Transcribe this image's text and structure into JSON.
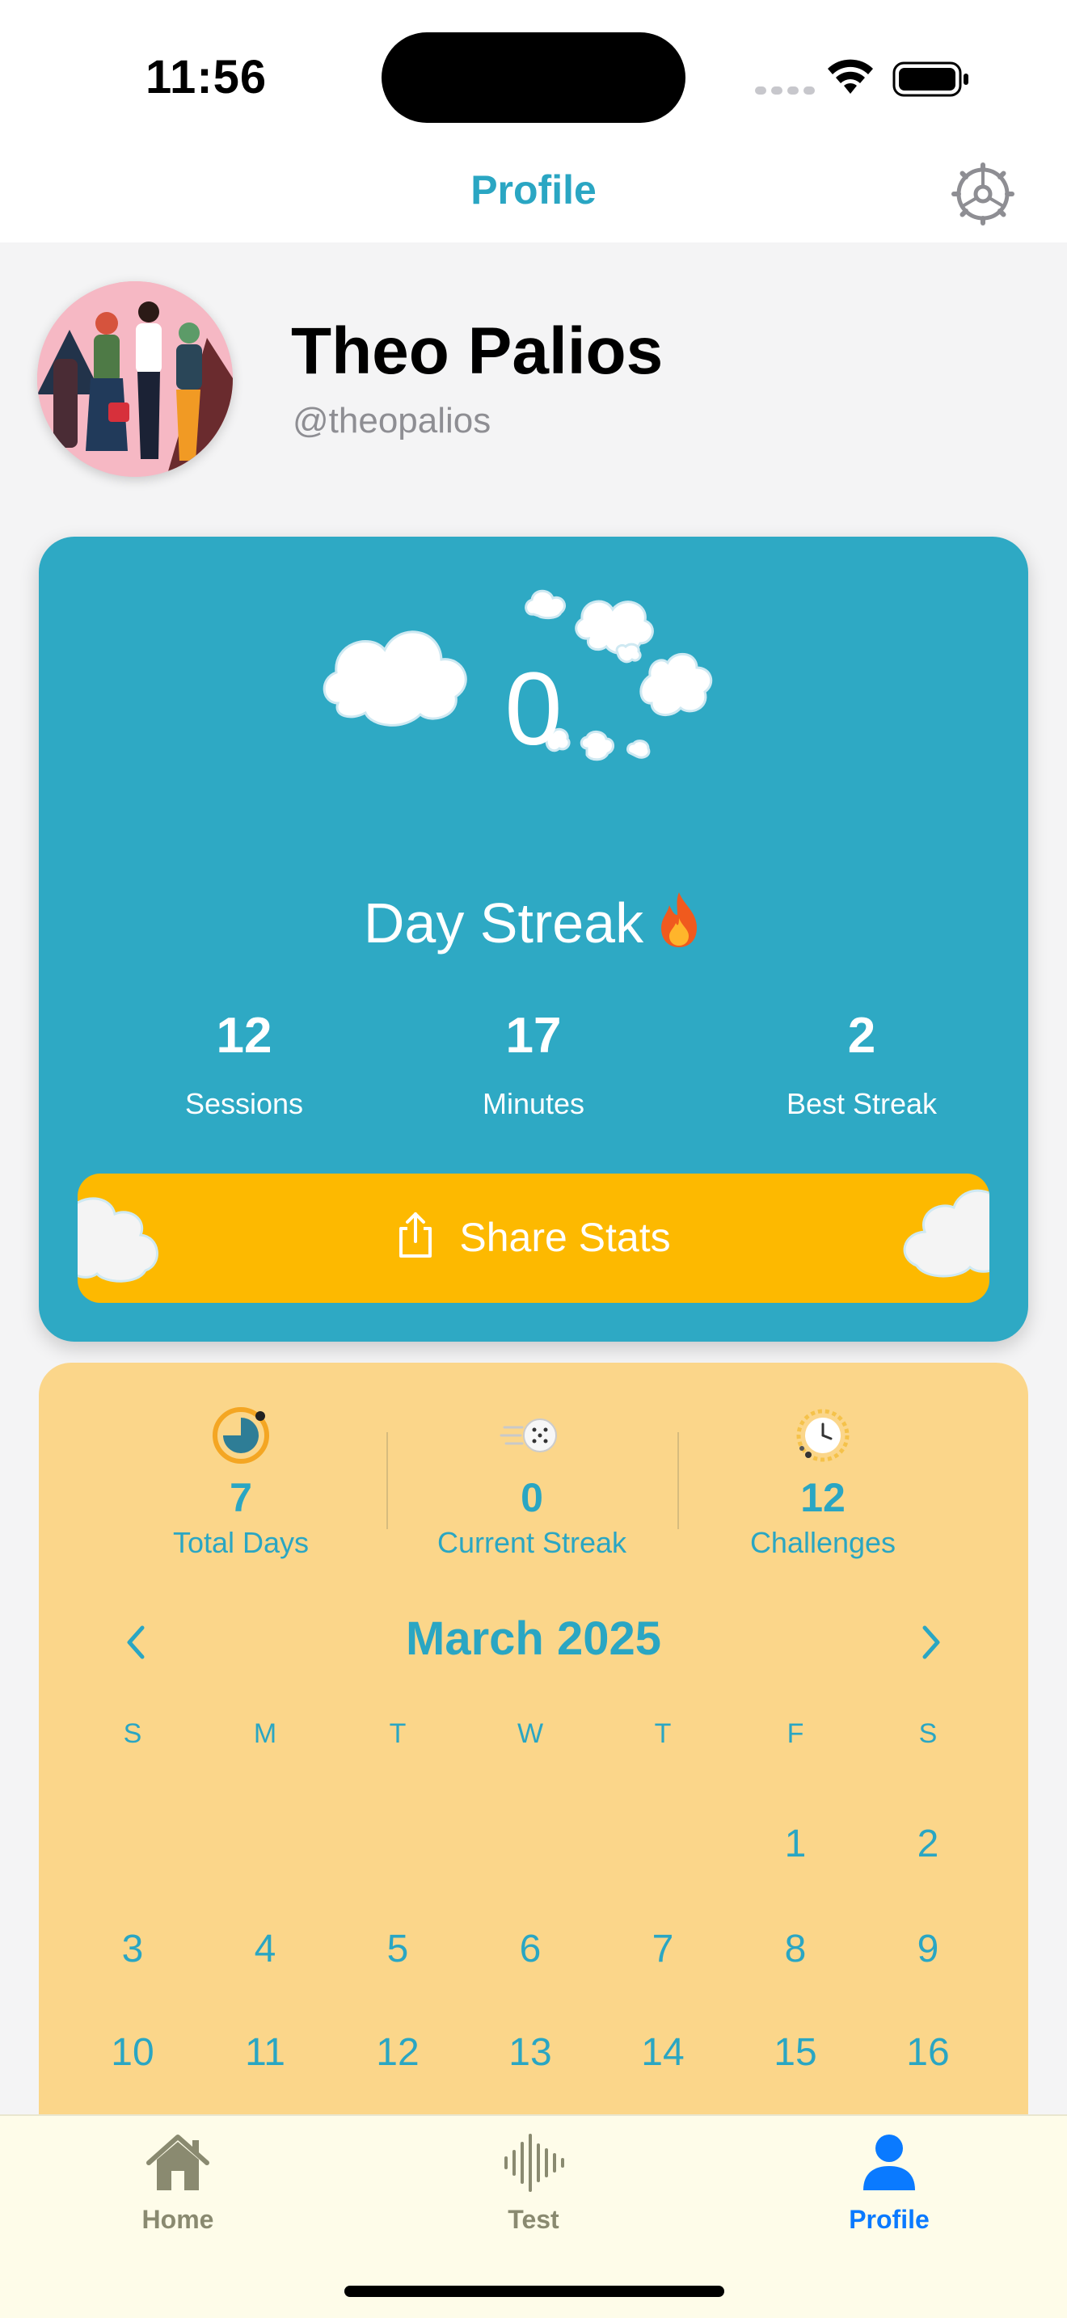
{
  "status_bar": {
    "time": "11:56"
  },
  "nav": {
    "title": "Profile",
    "settings_icon": "gear-icon"
  },
  "profile": {
    "name": "Theo Palios",
    "handle": "@theopalios"
  },
  "streak_card": {
    "streak_count": "0",
    "streak_label": "Day Streak",
    "stats": [
      {
        "value": "12",
        "label": "Sessions"
      },
      {
        "value": "17",
        "label": "Minutes"
      },
      {
        "value": "2",
        "label": "Best Streak"
      }
    ],
    "share_label": "Share Stats",
    "colors": {
      "card": "#2ea9c4",
      "share_button": "#fdb900"
    }
  },
  "calendar_card": {
    "mini_stats": [
      {
        "value": "7",
        "label": "Total Days",
        "icon": "pie-clock-icon"
      },
      {
        "value": "0",
        "label": "Current Streak",
        "icon": "dice-icon"
      },
      {
        "value": "12",
        "label": "Challenges",
        "icon": "clock-icon"
      }
    ],
    "month": "March 2025",
    "weekdays": [
      "S",
      "M",
      "T",
      "W",
      "T",
      "F",
      "S"
    ],
    "days": [
      "1",
      "2",
      "3",
      "4",
      "5",
      "6",
      "7",
      "8",
      "9",
      "10",
      "11",
      "12",
      "13",
      "14",
      "15",
      "16"
    ],
    "first_weekday_index": 5,
    "colors": {
      "card": "#fbd68a",
      "text": "#2aa6c3"
    }
  },
  "tab_bar": {
    "tabs": [
      {
        "label": "Home",
        "icon": "house-icon",
        "active": false
      },
      {
        "label": "Test",
        "icon": "waveform-icon",
        "active": false
      },
      {
        "label": "Profile",
        "icon": "person-icon",
        "active": true
      }
    ],
    "colors": {
      "active": "#0a7aff",
      "inactive": "#8a8a70"
    }
  }
}
